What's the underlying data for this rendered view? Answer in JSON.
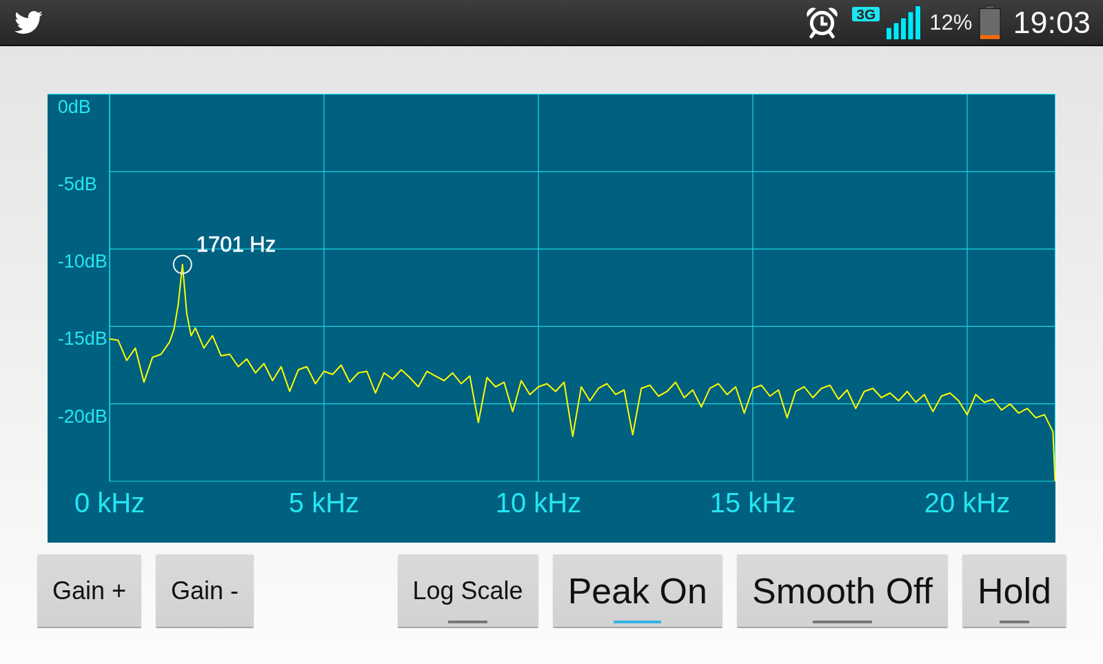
{
  "status_bar": {
    "network_badge": "3G",
    "battery": "12%",
    "time": "19:03"
  },
  "spectrum": {
    "chart_data": {
      "type": "line",
      "grid": true,
      "xlim": [
        0,
        22.05
      ],
      "ylim": [
        -25,
        0
      ],
      "xticks": [
        {
          "value": 0,
          "label": "0 kHz"
        },
        {
          "value": 5,
          "label": "5 kHz"
        },
        {
          "value": 10,
          "label": "10 kHz"
        },
        {
          "value": 15,
          "label": "15 kHz"
        },
        {
          "value": 20,
          "label": "20 kHz"
        }
      ],
      "yticks": [
        {
          "value": 0,
          "label": "0dB"
        },
        {
          "value": -5,
          "label": "-5dB"
        },
        {
          "value": -10,
          "label": "-10dB"
        },
        {
          "value": -15,
          "label": "-15dB"
        },
        {
          "value": -20,
          "label": "-20dB"
        }
      ],
      "x": [
        0,
        0.2,
        0.4,
        0.6,
        0.8,
        1,
        1.2,
        1.4,
        1.5,
        1.6,
        1.7,
        1.8,
        1.9,
        2,
        2.2,
        2.4,
        2.6,
        2.8,
        3,
        3.2,
        3.4,
        3.6,
        3.8,
        4,
        4.2,
        4.4,
        4.6,
        4.8,
        5,
        5.2,
        5.4,
        5.6,
        5.8,
        6,
        6.2,
        6.4,
        6.6,
        6.8,
        7,
        7.2,
        7.4,
        7.6,
        7.8,
        8,
        8.2,
        8.4,
        8.6,
        8.8,
        9,
        9.2,
        9.4,
        9.6,
        9.8,
        10,
        10.2,
        10.4,
        10.6,
        10.8,
        11,
        11.2,
        11.4,
        11.6,
        11.8,
        12,
        12.2,
        12.4,
        12.6,
        12.8,
        13,
        13.2,
        13.4,
        13.6,
        13.8,
        14,
        14.2,
        14.4,
        14.6,
        14.8,
        15,
        15.2,
        15.4,
        15.6,
        15.8,
        16,
        16.2,
        16.4,
        16.6,
        16.8,
        17,
        17.2,
        17.4,
        17.6,
        17.8,
        18,
        18.2,
        18.4,
        18.6,
        18.8,
        19,
        19.2,
        19.4,
        19.6,
        19.8,
        20,
        20.2,
        20.4,
        20.6,
        20.8,
        21,
        21.2,
        21.4,
        21.6,
        21.8,
        22,
        22.05
      ],
      "series": [
        {
          "color": "#ffff00",
          "values": [
            -15.8,
            -15.9,
            -17.2,
            -16.4,
            -18.6,
            -17.0,
            -16.8,
            -16.0,
            -15.2,
            -13.6,
            -11.0,
            -14.2,
            -15.6,
            -15.1,
            -16.4,
            -15.6,
            -16.9,
            -16.8,
            -17.6,
            -17.1,
            -18.0,
            -17.4,
            -18.5,
            -17.6,
            -19.2,
            -17.8,
            -17.6,
            -18.7,
            -17.9,
            -18.1,
            -17.5,
            -18.6,
            -18.0,
            -17.9,
            -19.3,
            -18.0,
            -18.4,
            -17.8,
            -18.3,
            -18.9,
            -17.9,
            -18.2,
            -18.5,
            -18.0,
            -18.7,
            -18.2,
            -21.2,
            -18.3,
            -18.9,
            -18.6,
            -20.5,
            -18.5,
            -19.4,
            -18.9,
            -18.7,
            -19.2,
            -18.6,
            -22.1,
            -18.9,
            -19.8,
            -19.0,
            -18.7,
            -19.4,
            -19.1,
            -22.0,
            -19.0,
            -18.8,
            -19.5,
            -19.2,
            -18.6,
            -19.6,
            -19.1,
            -20.2,
            -19.0,
            -18.7,
            -19.4,
            -18.9,
            -20.6,
            -19.0,
            -18.8,
            -19.5,
            -19.1,
            -20.9,
            -19.2,
            -18.9,
            -19.6,
            -19.0,
            -18.8,
            -19.7,
            -19.1,
            -20.3,
            -19.2,
            -19.0,
            -19.6,
            -19.3,
            -19.8,
            -19.2,
            -19.9,
            -19.4,
            -20.5,
            -19.5,
            -19.3,
            -19.8,
            -20.7,
            -19.4,
            -19.9,
            -19.7,
            -20.4,
            -20.0,
            -20.6,
            -20.3,
            -20.9,
            -20.7,
            -21.8,
            -25.0
          ]
        }
      ],
      "annotations": [
        {
          "text": "1701 Hz"
        }
      ]
    }
  },
  "buttons": [
    {
      "kind": "action",
      "label": "Gain +"
    },
    {
      "kind": "action",
      "label": "Gain -"
    },
    {
      "kind": "toggle",
      "label": "Log Scale",
      "on": false
    },
    {
      "kind": "toggle",
      "label": "Peak On",
      "on": true
    },
    {
      "kind": "toggle",
      "label": "Smooth Off",
      "on": false
    },
    {
      "kind": "toggle",
      "label": "Hold",
      "on": false
    }
  ]
}
